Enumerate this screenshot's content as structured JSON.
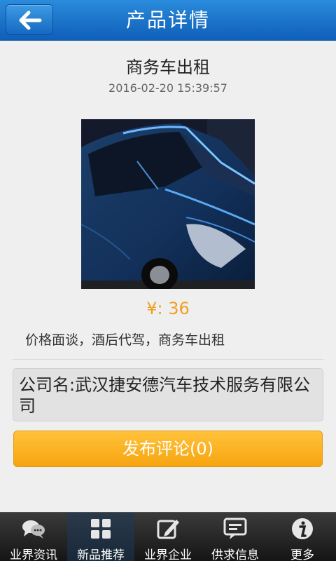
{
  "header": {
    "title": "产品详情"
  },
  "product": {
    "title": "商务车出租",
    "date": "2016-02-20 15:39:57",
    "price": "¥: 36",
    "description": "价格面谈，酒后代驾，商务车出租"
  },
  "company": {
    "text": "公司名:武汉捷安德汽车技术服务有限公司"
  },
  "comment_button": "发布评论(0)",
  "tabs": [
    {
      "label": "业界资讯",
      "icon": "chat-bubbles-icon"
    },
    {
      "label": "新品推荐",
      "icon": "grid-icon"
    },
    {
      "label": "业界企业",
      "icon": "edit-icon"
    },
    {
      "label": "供求信息",
      "icon": "message-icon"
    },
    {
      "label": "更多",
      "icon": "info-icon"
    }
  ],
  "colors": {
    "header": "#1a72c8",
    "price": "#f0a020",
    "button": "#f9ad1a"
  }
}
